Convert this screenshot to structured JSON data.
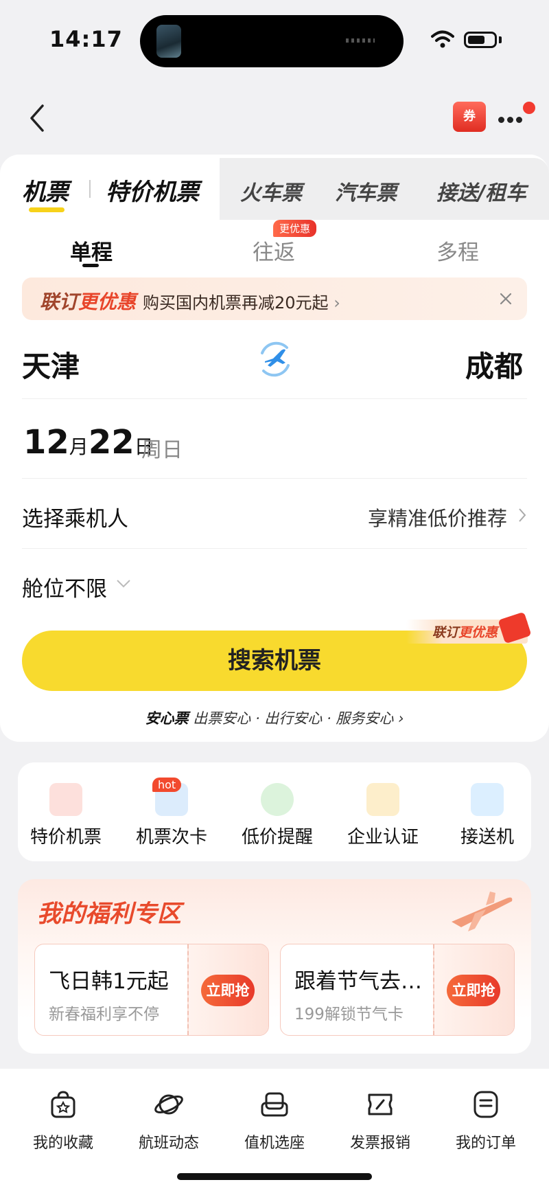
{
  "status_bar": {
    "time": "14:17"
  },
  "nav": {
    "coupon_label": "券"
  },
  "product_tabs": [
    {
      "label": "机票"
    },
    {
      "label": "特价机票"
    },
    {
      "label": "火车票"
    },
    {
      "label": "汽车票"
    },
    {
      "label": "接送/租车"
    }
  ],
  "trip_types": [
    {
      "label": "单程",
      "active": true
    },
    {
      "label": "往返",
      "badge": "更优惠"
    },
    {
      "label": "多程"
    }
  ],
  "promo": {
    "tag_prefix": "联订",
    "tag_highlight": "更优惠",
    "text": "购买国内机票再减20元起",
    "arrow": "›"
  },
  "route": {
    "from": "天津",
    "to": "成都"
  },
  "date": {
    "month": "12",
    "month_unit": "月",
    "day": "22",
    "day_unit": "日",
    "weekday": "周日"
  },
  "passenger": {
    "label": "选择乘机人",
    "hint": "享精准低价推荐"
  },
  "cabin": {
    "label": "舱位不限"
  },
  "search": {
    "button_label": "搜索机票",
    "tag_prefix": "联订",
    "tag_highlight": "更优惠"
  },
  "assurance": {
    "title": "安心票",
    "text": "出票安心 · 出行安心 · 服务安心 ›"
  },
  "quick_entries": [
    {
      "label": "特价机票",
      "icon": "plane-ticket-icon",
      "color": "#f7a5a5"
    },
    {
      "label": "机票次卡",
      "icon": "ticket-card-icon",
      "color": "#9cc9f5",
      "badge": "hot"
    },
    {
      "label": "低价提醒",
      "icon": "bell-plus-icon",
      "color": "#8fd68f"
    },
    {
      "label": "企业认证",
      "icon": "badge-icon",
      "color": "#f5c96a"
    },
    {
      "label": "接送机",
      "icon": "car-plane-icon",
      "color": "#a9d7f5"
    }
  ],
  "welfare": {
    "title": "我的福利专区",
    "cards": [
      {
        "title": "飞日韩1元起",
        "subtitle": "新春福利享不停",
        "button": "立即抢"
      },
      {
        "title": "跟着节气去…",
        "subtitle": "199解锁节气卡",
        "button": "立即抢"
      }
    ]
  },
  "bottom_nav": [
    {
      "label": "我的收藏",
      "icon": "favorite-bag-icon"
    },
    {
      "label": "航班动态",
      "icon": "planet-icon"
    },
    {
      "label": "值机选座",
      "icon": "seat-icon"
    },
    {
      "label": "发票报销",
      "icon": "invoice-ticket-icon"
    },
    {
      "label": "我的订单",
      "icon": "order-list-icon"
    }
  ],
  "colors": {
    "accent_yellow": "#f8da2e",
    "promo_red": "#e8452a",
    "text_primary": "#111111"
  }
}
